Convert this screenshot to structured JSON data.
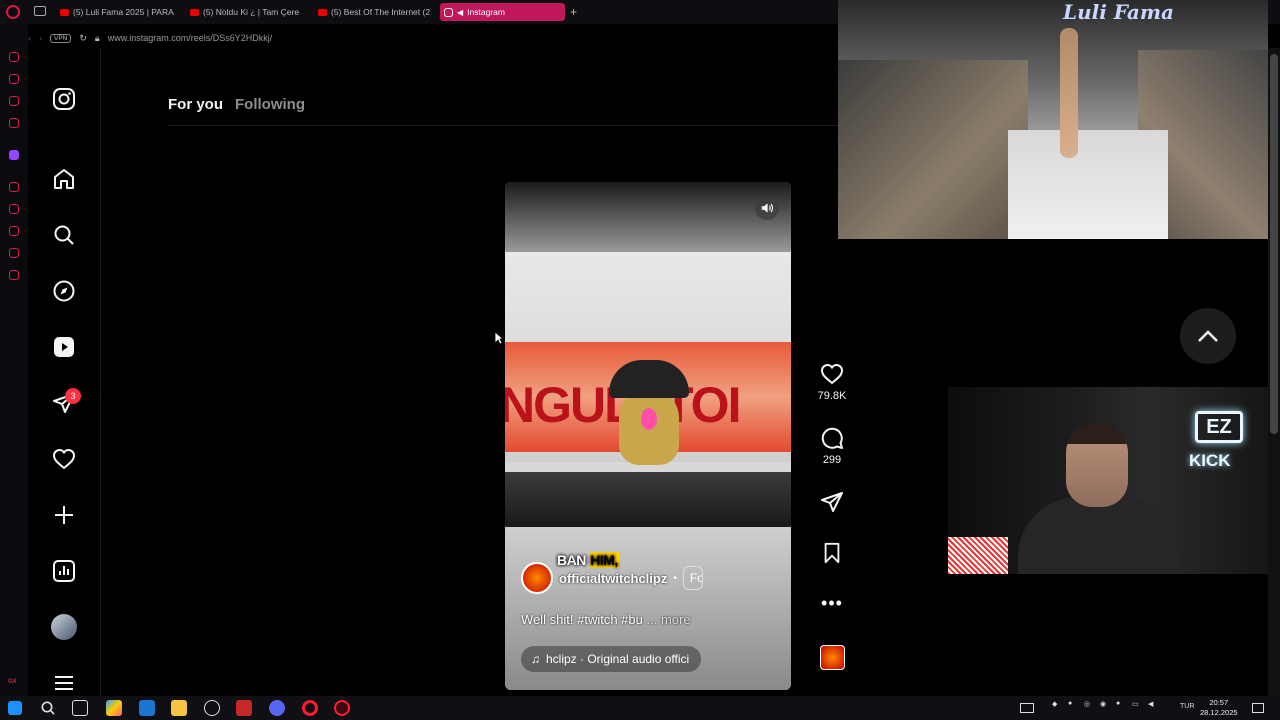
{
  "browser": {
    "tabs": [
      {
        "label": "(5) Luli Fama 2025 | PARA"
      },
      {
        "label": "(5) Noldu Ki ¿ | Tam Çere"
      },
      {
        "label": "(5) Best Of The Internet (2"
      },
      {
        "label": "Instagram"
      }
    ],
    "vpn_label": "VPN",
    "url": "www.instagram.com/reels/DSs6Y2HDkkj/"
  },
  "nav": {
    "notification_badge": "3",
    "icons": [
      "instagram-icon",
      "home-icon",
      "search-icon",
      "explore-icon",
      "reels-icon",
      "messages-icon",
      "notifications-icon",
      "create-icon",
      "dashboard-icon",
      "profile-avatar",
      "menu-icon"
    ]
  },
  "feed": {
    "tab_for_you": "For you",
    "tab_following": "Following"
  },
  "reel": {
    "sign_text": "NGULATOI",
    "caption_pre": "BAN ",
    "caption_hl": "HIM,",
    "username": "officialtwitchclipz",
    "dot": "•",
    "follow": "Fo",
    "description": "Well shit! #twitch #bu",
    "more": "... more",
    "audio": "hclipz · Original audio  offici",
    "likes": "79.8K",
    "comments": "299"
  },
  "overlay": {
    "runway_logo": "Luli Fama",
    "webcam_ez": "EZ",
    "webcam_kick": "KICK"
  },
  "taskbar": {
    "lang": "TUR",
    "time": "20:57",
    "date": "28.12.2025"
  },
  "colors": {
    "accent": "#c2185b",
    "badge": "#ff3040",
    "opera": "#d4233f"
  }
}
